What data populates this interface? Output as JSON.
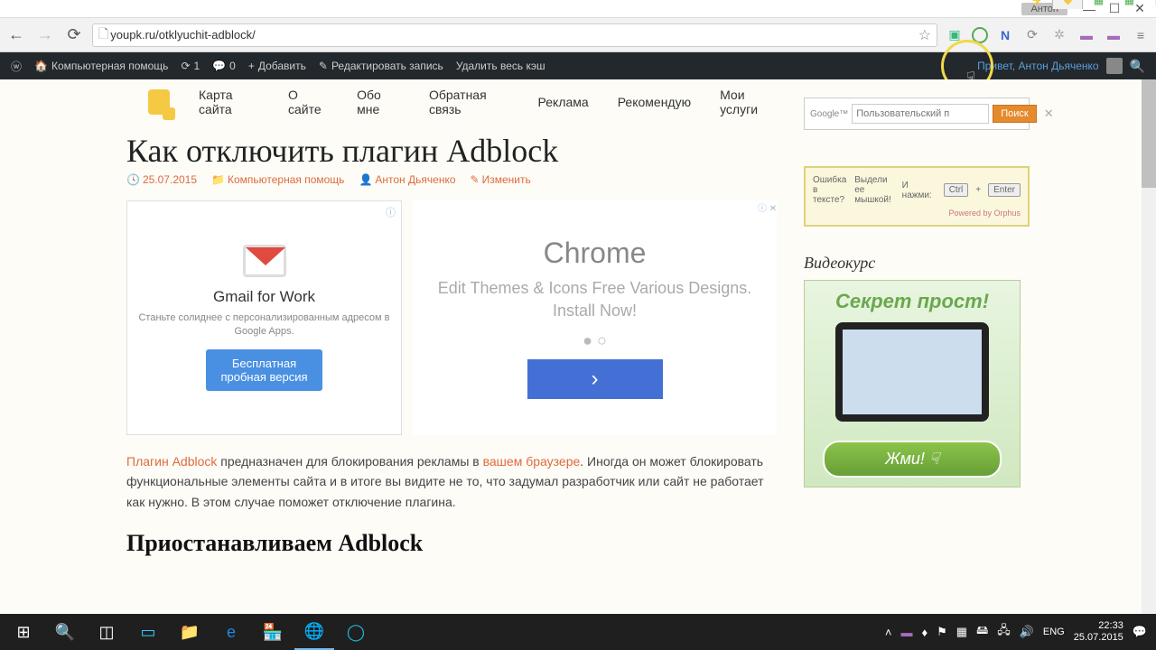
{
  "browser": {
    "profile": "Антон",
    "url": "youpk.ru/otklyuchit-adblock/"
  },
  "wpbar": {
    "site": "Компьютерная помощь",
    "updates": "1",
    "comments": "0",
    "add": "Добавить",
    "edit": "Редактировать запись",
    "cache": "Удалить весь кэш",
    "greeting": "Привет, Антон Дьяченко"
  },
  "nav": {
    "items": [
      "Карта сайта",
      "О сайте",
      "Обо мне",
      "Обратная связь",
      "Реклама",
      "Рекомендую",
      "Мои услуги"
    ]
  },
  "post": {
    "title": "Как отключить плагин Adblock",
    "date": "25.07.2015",
    "category": "Компьютерная помощь",
    "author": "Антон Дьяченко",
    "edit": "Изменить",
    "para_link1": "Плагин Adblock",
    "para_mid": " предназначен для блокирования рекламы в ",
    "para_link2": "вашем браузере",
    "para_rest": ". Иногда он может блокировать функциональные элементы сайта и в итоге вы видите не то, что задумал разработчик или сайт не работает как нужно. В этом случае поможет отключение плагина.",
    "h2": "Приостанавливаем Adblock"
  },
  "ad1": {
    "title": "Gmail for Work",
    "sub": "Станьте солиднее с персонализированным адресом в Google Apps.",
    "btn": "Бесплатная\nпробная версия"
  },
  "ad2": {
    "title": "Chrome",
    "sub": "Edit Themes & Icons Free Various Designs. Install Now!",
    "arrow": "›"
  },
  "sidebar": {
    "search_placeholder": "Пользовательский п",
    "search_btn": "Поиск",
    "google": "Google™",
    "orphus": {
      "l1a": "Ошибка",
      "l1b": "в тексте?",
      "l2a": "Выдели ее",
      "l2b": "мышкой!",
      "l3": "И нажми:",
      "k1": "Ctrl",
      "k2": "Enter",
      "pow": "Powered by Orphus"
    },
    "video_h": "Видеокурс",
    "banner_h": "Секрет прост!",
    "banner_cta": "Жми!"
  },
  "taskbar": {
    "lang": "ENG",
    "time": "22:33",
    "date": "25.07.2015"
  }
}
